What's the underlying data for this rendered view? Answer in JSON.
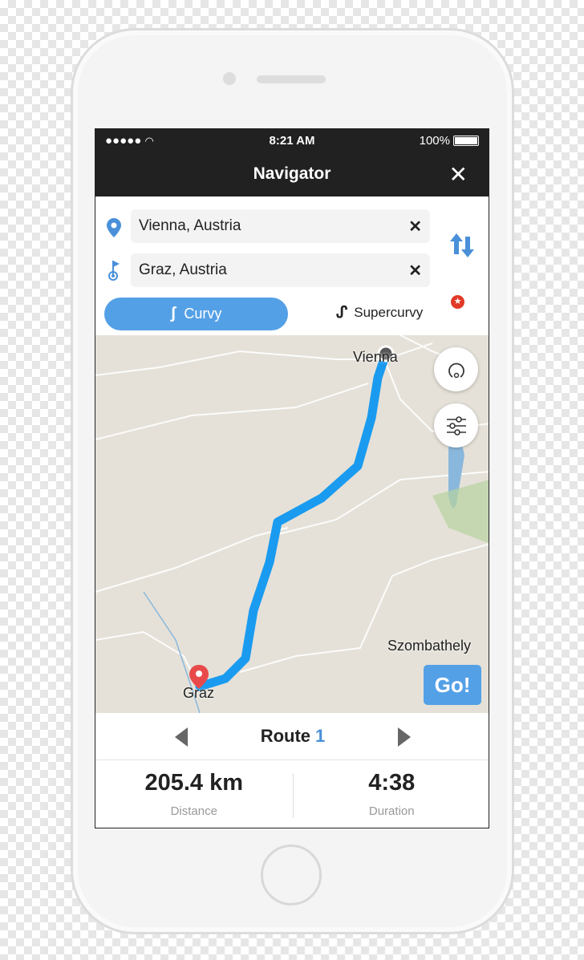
{
  "status_bar": {
    "time": "8:21 AM",
    "battery": "100%",
    "battery_level": 1.0
  },
  "header": {
    "title": "Navigator",
    "close_icon": "close-icon"
  },
  "route_inputs": {
    "origin": "Vienna, Austria",
    "destination": "Graz, Austria"
  },
  "modes": {
    "curvy": "Curvy",
    "supercurvy": "Supercurvy",
    "selected": "Curvy",
    "premium_badge": "★"
  },
  "map": {
    "labels": {
      "start": "Vienna",
      "end": "Graz",
      "city": "Szombathely"
    },
    "go_label": "Go!",
    "route_color": "#1a9bf0"
  },
  "route_selector": {
    "label": "Route",
    "number": "1"
  },
  "stats": {
    "distance": {
      "value": "205.4 km",
      "label": "Distance"
    },
    "duration": {
      "value": "4:38",
      "label": "Duration"
    }
  },
  "colors": {
    "accent": "#54a0e6",
    "header_bg": "#212121"
  }
}
